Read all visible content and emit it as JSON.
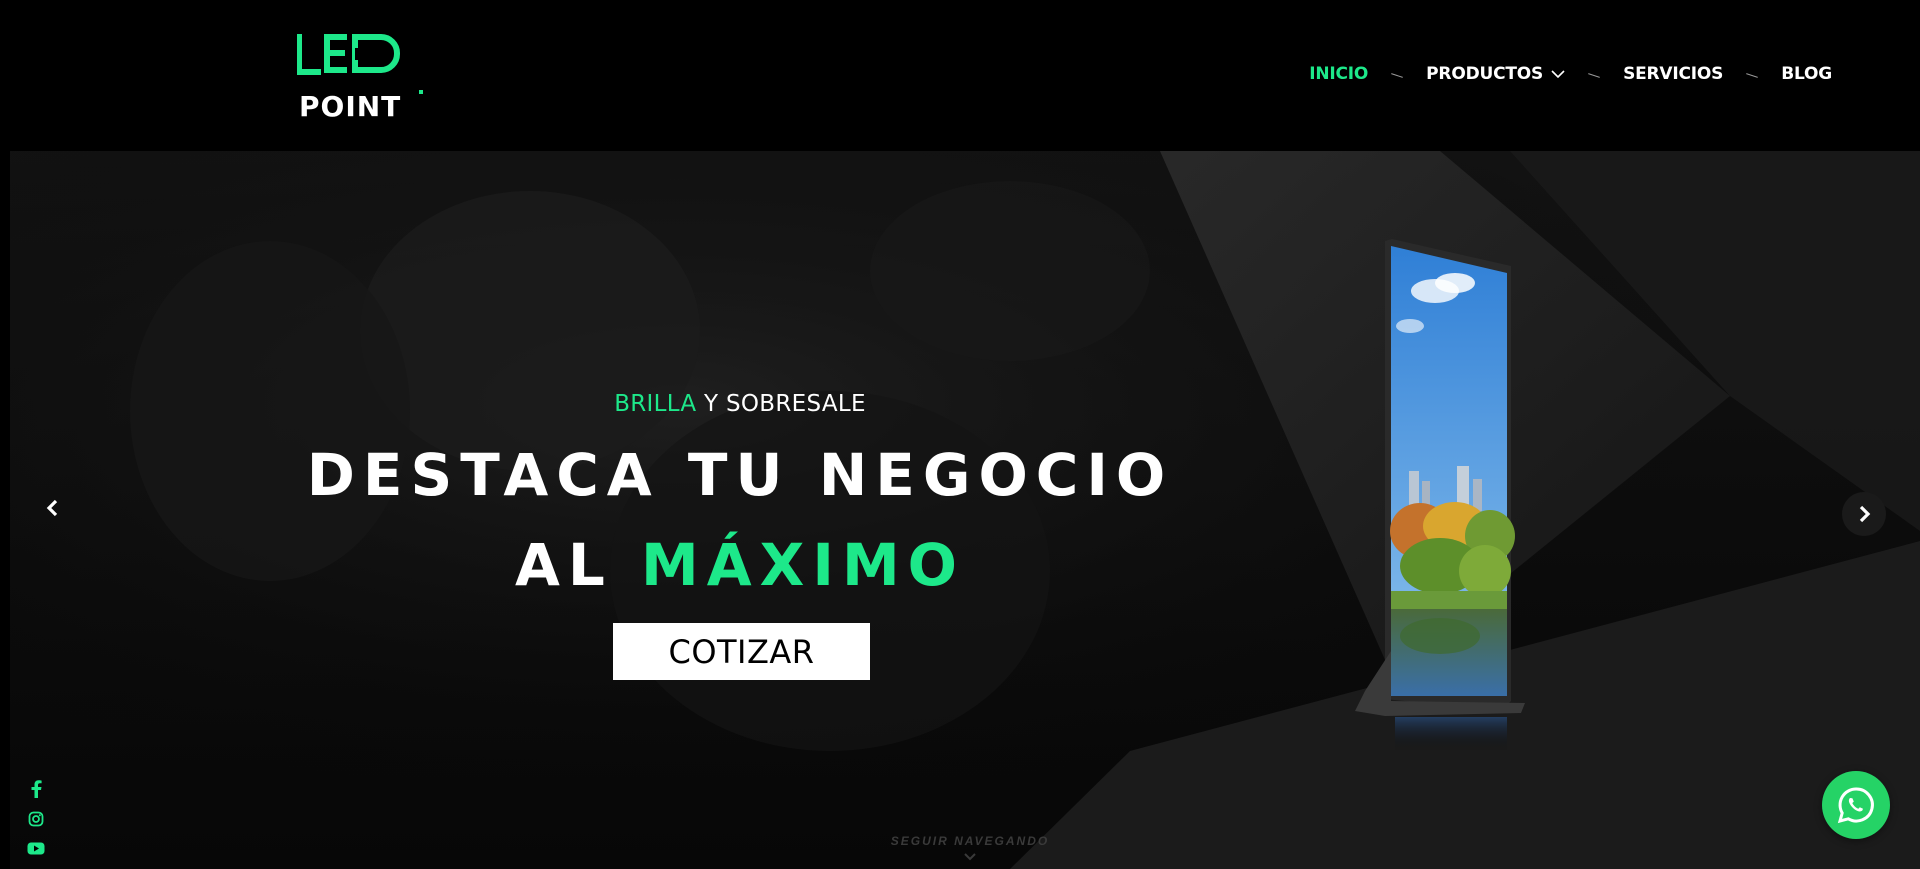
{
  "logo": {
    "line1": "LED",
    "line2": "POINT"
  },
  "nav": {
    "items": [
      {
        "label": "INICIO",
        "active": true
      },
      {
        "label": "PRODUCTOS",
        "has_dropdown": true
      },
      {
        "label": "SERVICIOS"
      },
      {
        "label": "BLOG"
      }
    ]
  },
  "hero": {
    "kicker_accent": "BRILLA",
    "kicker_rest": " Y SOBRESALE",
    "title_line1": "DESTACA TU NEGOCIO",
    "title_line2_prefix": "AL ",
    "title_line2_accent": "MÁXIMO",
    "cta_label": "COTIZAR",
    "scroll_hint": "SEGUIR NAVEGANDO"
  },
  "carousel": {
    "prev_icon": "chevron-left-icon",
    "next_icon": "chevron-right-icon"
  },
  "social": [
    {
      "icon": "facebook-icon"
    },
    {
      "icon": "instagram-icon"
    },
    {
      "icon": "youtube-icon"
    }
  ],
  "whatsapp": {
    "icon": "whatsapp-icon"
  },
  "colors": {
    "accent": "#1de88a",
    "background": "#000000",
    "whatsapp": "#25d366"
  }
}
